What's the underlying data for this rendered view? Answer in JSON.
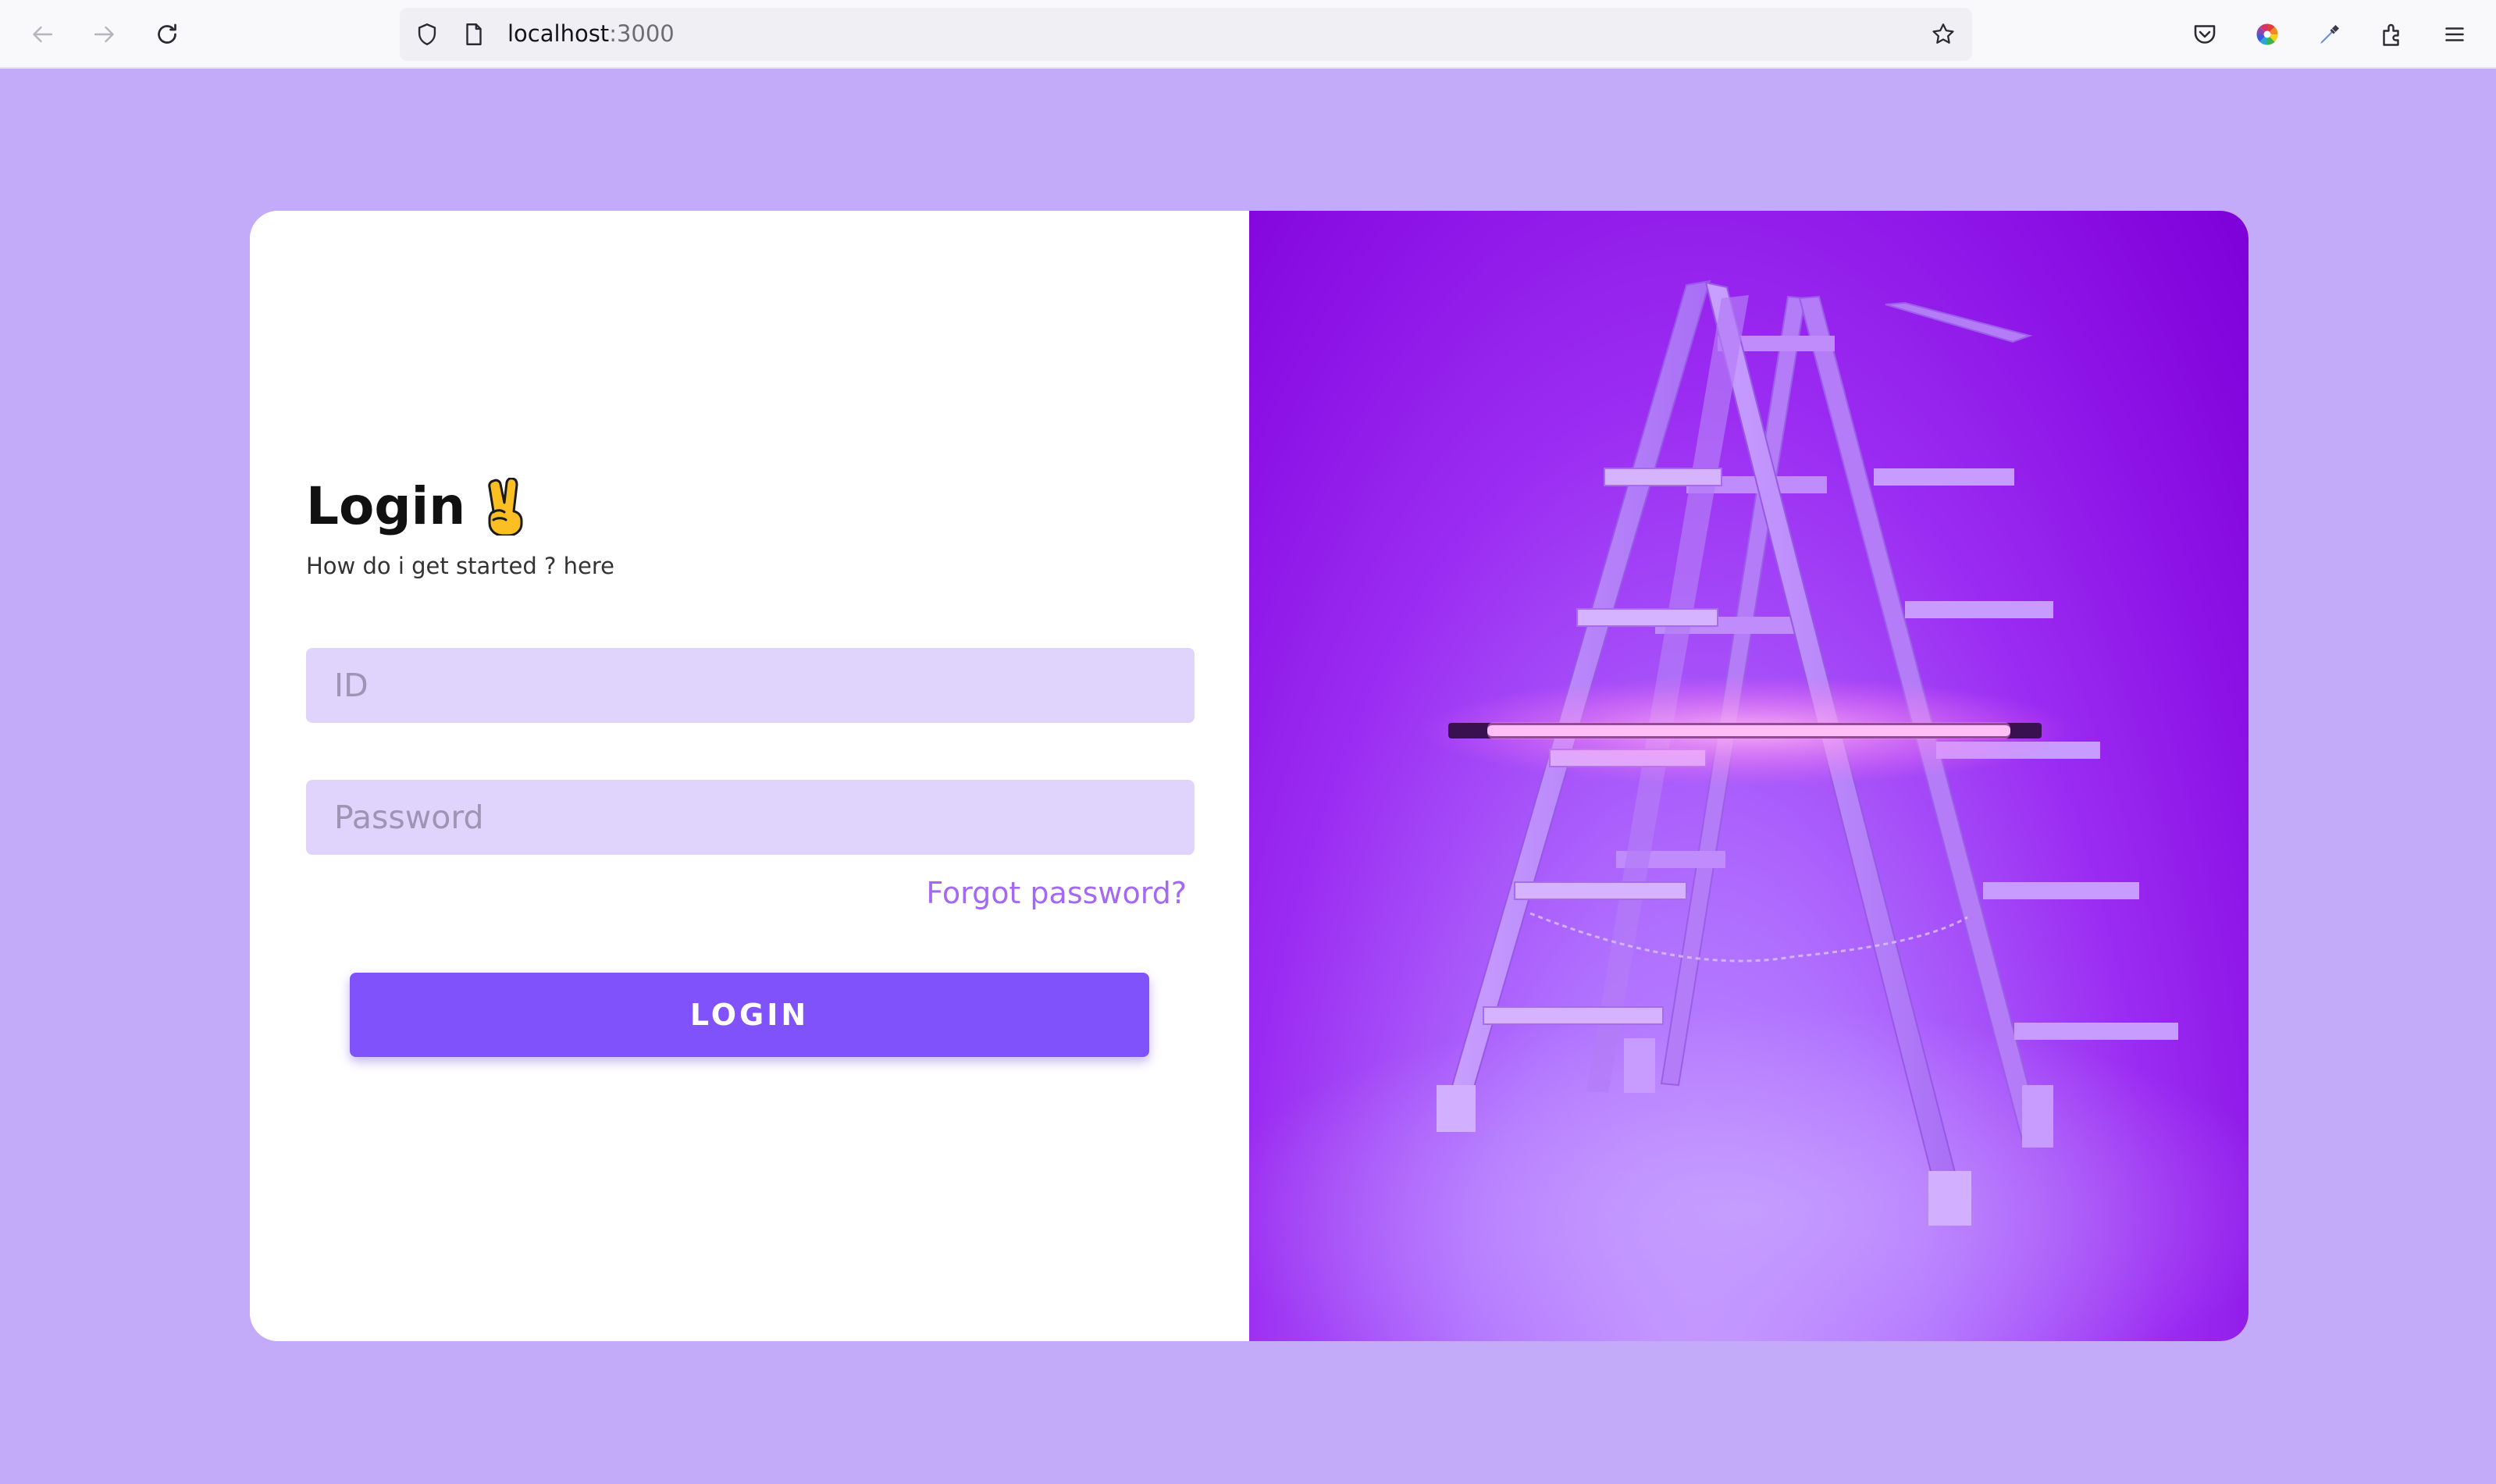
{
  "browser": {
    "url_host": "localhost",
    "url_port": ":3000",
    "icons": [
      "back-icon",
      "forward-icon",
      "reload-icon",
      "shield-icon",
      "page-icon",
      "bookmark-star-icon",
      "pocket-icon",
      "color-wheel-icon",
      "eyedropper-icon",
      "extensions-icon",
      "menu-icon"
    ]
  },
  "login": {
    "title": "Login",
    "subtitle": "How do i get started ? here",
    "id_placeholder": "ID",
    "password_placeholder": "Password",
    "forgot_label": "Forgot password?",
    "button_label": "LOGIN"
  },
  "colors": {
    "page_background": "#c3abfa",
    "input_background": "#e0d4fd",
    "button": "#7f52fb",
    "link": "#a469f2",
    "hero_purple": "#8c12e6"
  }
}
